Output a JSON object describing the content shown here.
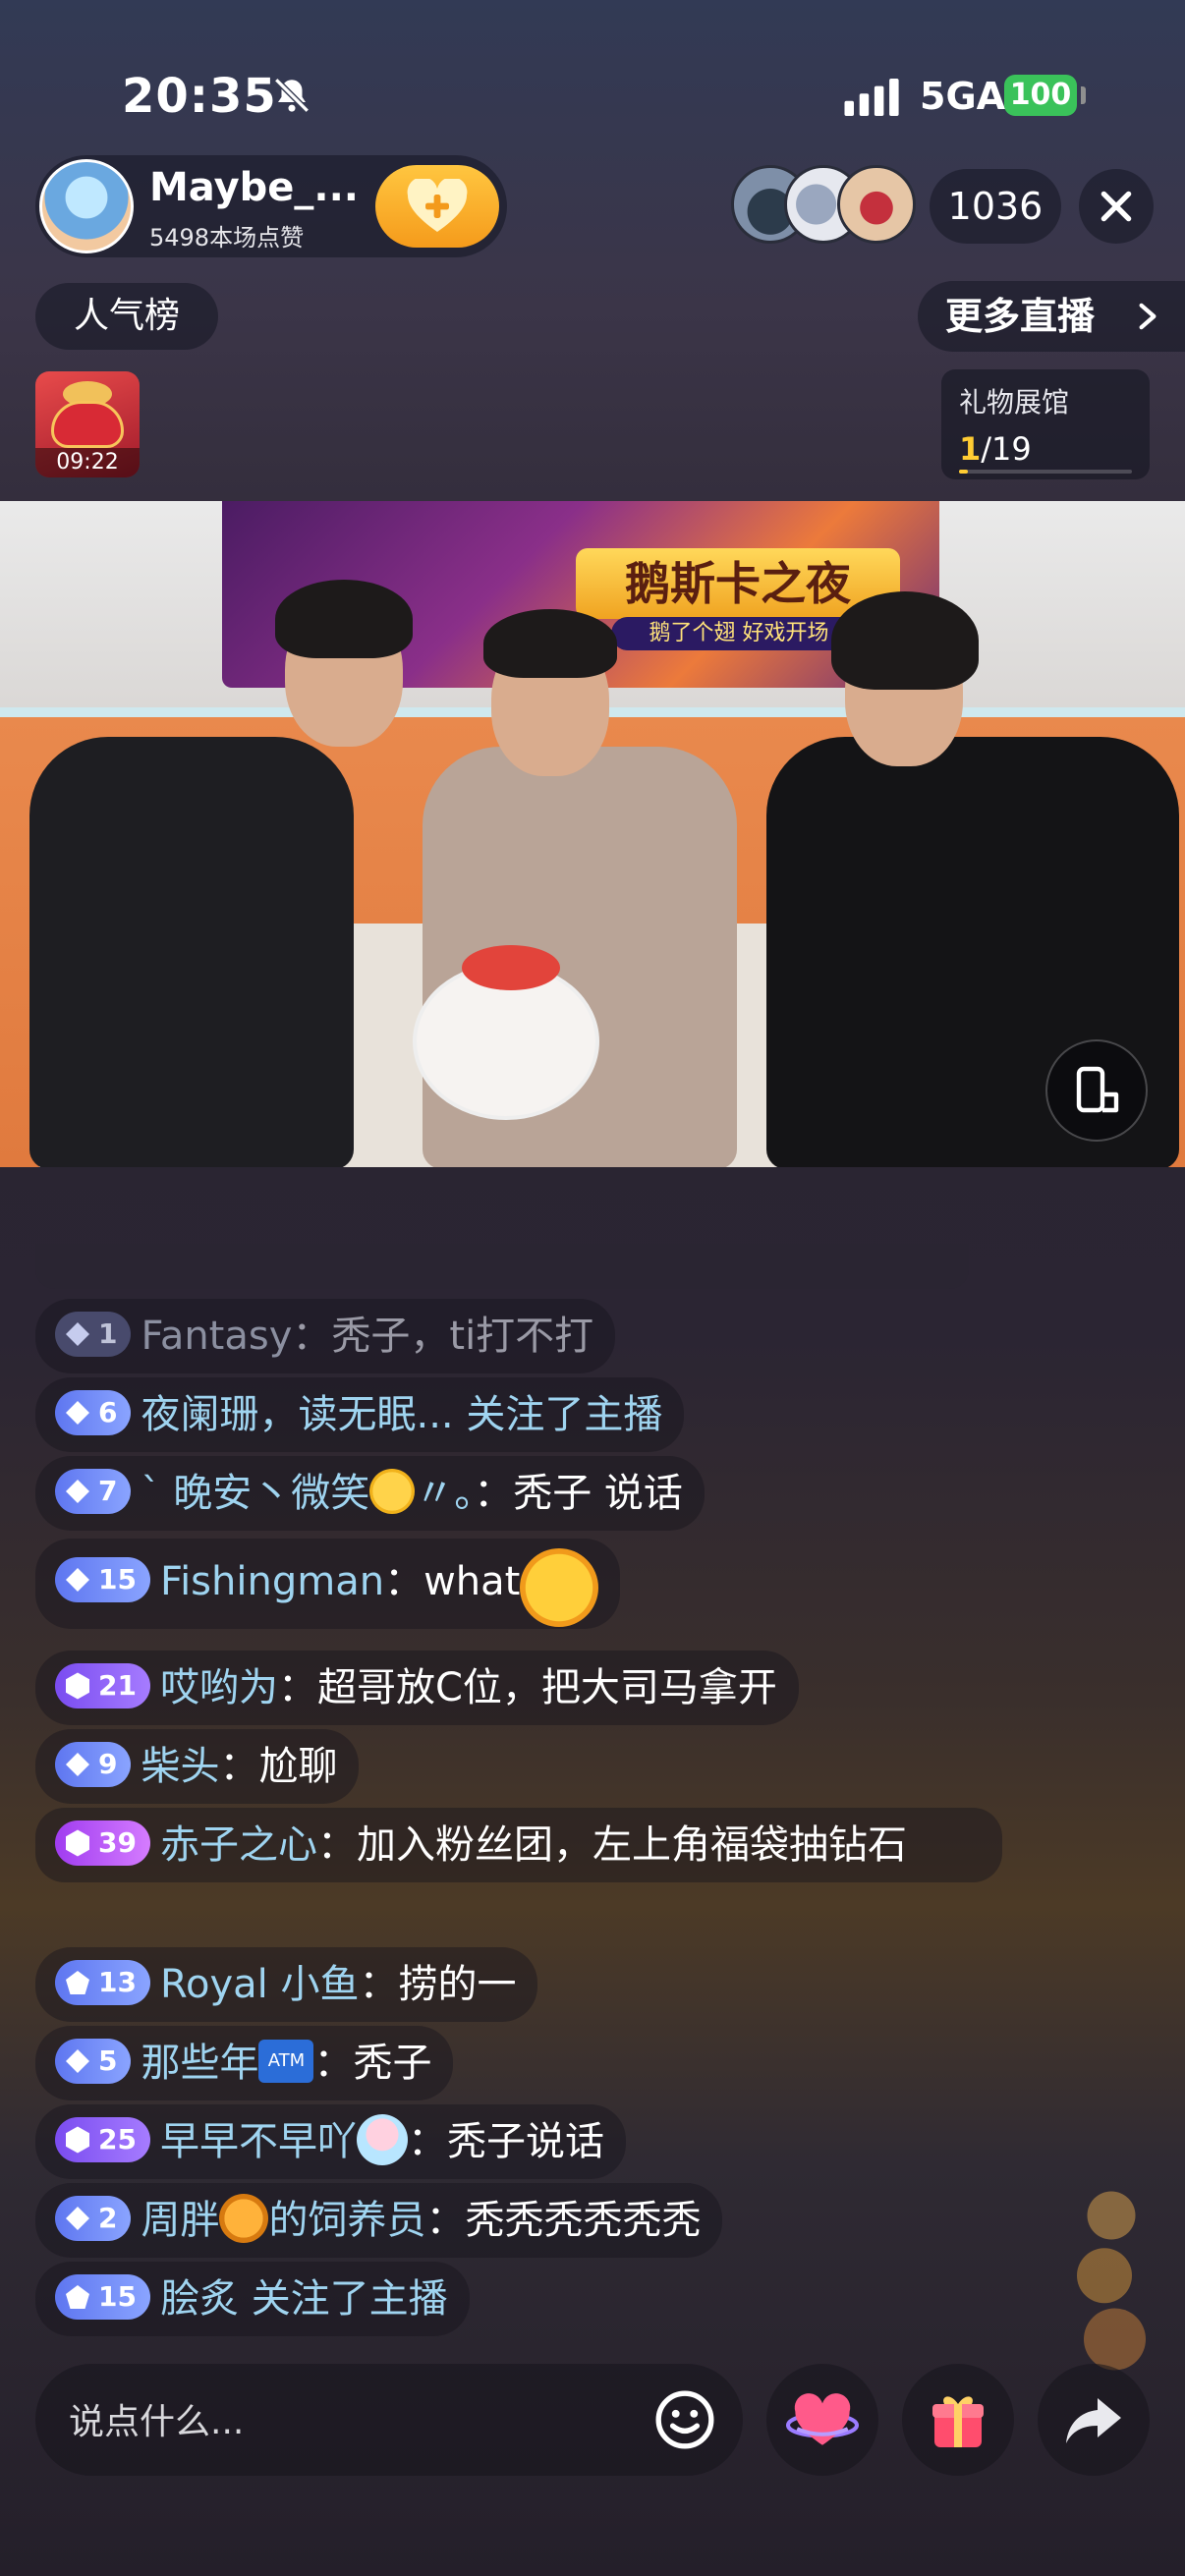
{
  "status_bar": {
    "time": "20:35",
    "network": "5GA",
    "battery": "100",
    "icons": [
      "bell-muted-icon",
      "signal-icon"
    ]
  },
  "host": {
    "name": "Maybe_...",
    "likes": "5498本场点赞",
    "follow_icon": "plus-heart-icon"
  },
  "viewers": {
    "count": "1036"
  },
  "rank_label": "人气榜",
  "more_live_label": "更多直播",
  "lucky_bag": {
    "time": "09:22"
  },
  "gift_hall": {
    "title": "礼物展馆",
    "current": "1",
    "total": "/19",
    "progress_fraction": 0.053,
    "accent": "#ffcc33"
  },
  "video": {
    "tv_title": "鹅斯卡之夜",
    "tv_subtitle": "鹅了个翅 好戏开场"
  },
  "chat": {
    "messages": [
      {
        "level": "1",
        "badge": "faded",
        "user": "Fantasy",
        "sep": "：",
        "text": "秃子，ti打不打",
        "faded": true
      },
      {
        "level": "6",
        "badge": "blue",
        "user": "夜阑珊，读无眠...",
        "sep": " ",
        "text": "关注了主播"
      },
      {
        "level": "7",
        "badge": "blue",
        "user": "` 晚安丶微笑",
        "emoji": "smile",
        "user_suffix": "〃。",
        "sep": "：",
        "text": "秃子  说话"
      },
      {
        "level": "15",
        "badge": "blue",
        "user": "Fishingman",
        "sep": "：",
        "text": "what",
        "emoji_after": "laugh"
      },
      {
        "level": "21",
        "badge": "purple",
        "user": "哎哟为",
        "sep": "：",
        "text": "超哥放C位，把大司马拿开"
      },
      {
        "level": "9",
        "badge": "blue",
        "user": "柴头",
        "sep": "：",
        "text": "尬聊"
      },
      {
        "level": "39",
        "badge": "magenta",
        "user": "赤子之心",
        "sep": "：",
        "text": "加入粉丝团，左上角福袋抽钻石"
      },
      {
        "level": "13",
        "badge": "blue",
        "user": "Royal 小鱼",
        "sep": "：",
        "text": "捞的一"
      },
      {
        "level": "5",
        "badge": "blue",
        "user": "那些年",
        "emoji": "atm",
        "sep": "：",
        "text": "秃子"
      },
      {
        "level": "25",
        "badge": "purple",
        "user": "早早不早吖",
        "emoji": "fairy",
        "sep": "：",
        "text": "秃子说话"
      },
      {
        "level": "2",
        "badge": "blue",
        "user": "周胖",
        "emoji": "tiger",
        "user_suffix": "的饲养员",
        "sep": "：",
        "text": "秃秃秃秃秃秃"
      },
      {
        "level": "15",
        "badge": "blue",
        "user": "脍炙",
        "sep": " ",
        "text": "关注了主播"
      }
    ]
  },
  "bottom_bar": {
    "placeholder": "说点什么...",
    "icons": [
      "emoji-icon",
      "heart-planet-icon",
      "gift-icon",
      "share-icon"
    ]
  },
  "colors": {
    "username": "#9fd4f0",
    "battery": "#3ac25a",
    "follow_button": "#f5a623"
  }
}
